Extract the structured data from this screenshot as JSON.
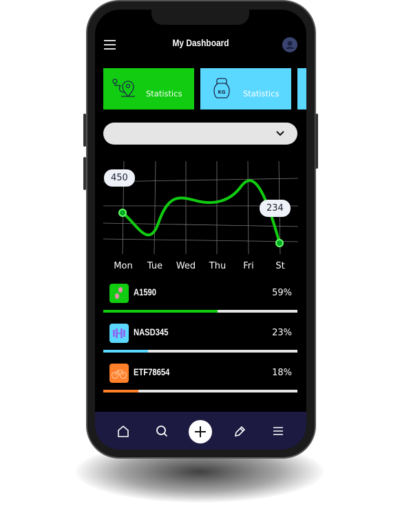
{
  "header": {
    "title": "My Dashboard",
    "menu_icon": "hamburger-icon",
    "avatar_icon": "user-icon"
  },
  "cards": [
    {
      "label": "Statistics",
      "icon": "map-route-icon",
      "color": "#11cc11"
    },
    {
      "label": "Statistics",
      "icon": "kettlebell-icon",
      "icon_text": "KG",
      "color": "#5bd8ff"
    }
  ],
  "dropdown": {
    "value": "",
    "icon": "chevron-down-icon"
  },
  "chart": {
    "days": [
      "Mon",
      "Tue",
      "Wed",
      "Thu",
      "Fri",
      "St"
    ],
    "callouts": [
      {
        "day": "Mon",
        "value": "450"
      },
      {
        "day": "St",
        "value": "234"
      }
    ],
    "line_color": "#11cc11"
  },
  "assets": [
    {
      "name": "A1590",
      "percent": "59%",
      "fraction": 0.59,
      "color": "#11cc11",
      "icon": "footprints-icon"
    },
    {
      "name": "NASD345",
      "percent": "23%",
      "fraction": 0.23,
      "color": "#5bd8ff",
      "icon": "dumbbell-icon"
    },
    {
      "name": "ETF78654",
      "percent": "18%",
      "fraction": 0.18,
      "color": "#ff7f2a",
      "icon": "bicycle-icon"
    }
  ],
  "nav": [
    "home-icon",
    "search-icon",
    "plus-icon",
    "edit-icon",
    "menu-icon"
  ]
}
